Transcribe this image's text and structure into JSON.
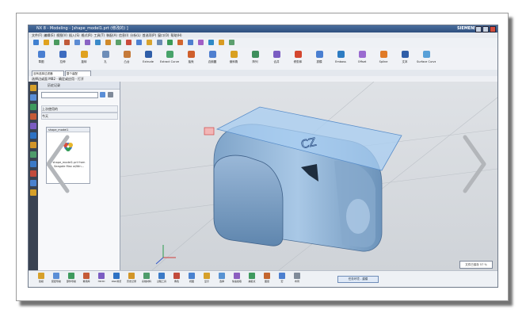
{
  "window": {
    "title": "NX 8 - Modeling - [shape_model1.prt (修改的) ]",
    "brand": "SIEMENS"
  },
  "menu": [
    "文件(F)",
    "编辑(E)",
    "视图(V)",
    "插入(S)",
    "格式(R)",
    "工具(T)",
    "装配(A)",
    "信息(I)",
    "分析(L)",
    "首选项(P)",
    "窗口(O)",
    "帮助(H)"
  ],
  "ribbon": {
    "buttons": [
      {
        "label": "草图",
        "icon": "sketch-icon",
        "color": "#4a7fd1"
      },
      {
        "label": "拉伸",
        "icon": "extrude-icon",
        "color": "#3d6cc0"
      },
      {
        "label": "旋转",
        "icon": "revolve-icon",
        "color": "#e0a21f"
      },
      {
        "label": "孔",
        "icon": "hole-icon",
        "color": "#6d8db8"
      },
      {
        "label": "凸台",
        "icon": "boss-icon",
        "color": "#c57a3a"
      },
      {
        "label": "Extrude",
        "icon": "extrude2-icon",
        "color": "#2f5ea8"
      },
      {
        "label": "Extract Curve",
        "icon": "curve-icon",
        "color": "#48a36a"
      },
      {
        "label": "抽壳",
        "icon": "shell-icon",
        "color": "#cf5f2c"
      },
      {
        "label": "边倒圆",
        "icon": "blend-icon",
        "color": "#4f7fd0"
      },
      {
        "label": "倒斜角",
        "icon": "chamfer-icon",
        "color": "#d9a020"
      },
      {
        "label": "阵列",
        "icon": "pattern-icon",
        "color": "#3d8f5c"
      },
      {
        "label": "合并",
        "icon": "unite-icon",
        "color": "#7a5cc2"
      },
      {
        "label": "修剪体",
        "icon": "trim-icon",
        "color": "#d4462f"
      },
      {
        "label": "拔模",
        "icon": "draft-icon",
        "color": "#4a7fd1"
      },
      {
        "label": "Emboss",
        "icon": "emboss-icon",
        "color": "#2e7cc2"
      },
      {
        "label": "Offset",
        "icon": "offset-icon",
        "color": "#9a6ad0"
      },
      {
        "label": "Spline",
        "icon": "spline-icon",
        "color": "#e07b28"
      },
      {
        "label": "文本",
        "icon": "text-icon",
        "color": "#2f5ea8"
      },
      {
        "label": "Surface Curve",
        "icon": "surface-icon",
        "color": "#58a0d8"
      }
    ]
  },
  "selection": {
    "filter": "没有选择过滤器",
    "scope": "整个装配"
  },
  "cue": "选择边或面 MB2 - 确定或应用 - 打开",
  "nav": {
    "header": "历史记录",
    "section1": "上次使用的",
    "section2": "今天",
    "card_title": "shape_model1",
    "card_label": "shape_model1.prt from Seagate Max w/Win..."
  },
  "viewport": {
    "status": "文件已保存 57 %",
    "emboss_text": "CZ",
    "axis_labels": [
      "X",
      "Y",
      "Z"
    ]
  },
  "bottom": {
    "buttons": [
      {
        "label": "建模",
        "color": "#d6a02a"
      },
      {
        "label": "装配导航",
        "color": "#5a8ed6"
      },
      {
        "label": "部件导航",
        "color": "#3e9a5e"
      },
      {
        "label": "重用库",
        "color": "#c55b38"
      },
      {
        "label": "HD3D",
        "color": "#7a5cc2"
      },
      {
        "label": "Web浏览",
        "color": "#2d72c4"
      },
      {
        "label": "历史记录",
        "color": "#d2962a"
      },
      {
        "label": "系统材料",
        "color": "#4e9c6b"
      },
      {
        "label": "过程工具",
        "color": "#3b7ac7"
      },
      {
        "label": "角色",
        "color": "#c24b3c"
      },
      {
        "label": "视图",
        "color": "#4a82cf"
      },
      {
        "label": "显示",
        "color": "#d6a02a"
      },
      {
        "label": "选择",
        "color": "#5893d3"
      },
      {
        "label": "快速拾取",
        "color": "#8c5fc0"
      },
      {
        "label": "捕捉点",
        "color": "#3f9a5f"
      },
      {
        "label": "图层",
        "color": "#c4662f"
      },
      {
        "label": "宏",
        "color": "#4c7fcf"
      },
      {
        "label": "布局",
        "color": "#7f8a99"
      }
    ],
    "task": "任务环境 - 建模"
  },
  "carousel": {
    "prev": "‹",
    "next": "›"
  }
}
